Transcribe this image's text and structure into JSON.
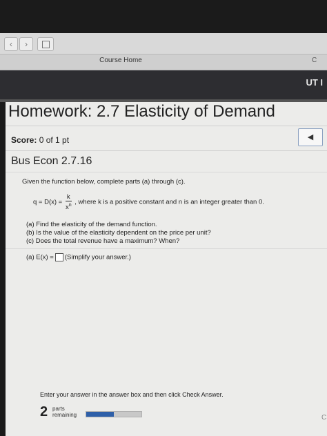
{
  "browser": {
    "back_icon": "‹",
    "forward_icon": "›",
    "tab_course_home": "Course Home",
    "tab_right_clip": "C"
  },
  "banner": {
    "text": "UT I"
  },
  "homework": {
    "title": "Homework: 2.7 Elasticity of Demand",
    "score_label": "Score:",
    "score_value": "0 of 1 pt",
    "nav_icon": "◀"
  },
  "question": {
    "id": "Bus Econ 2.7.16",
    "instruction": "Given the function below, complete parts (a) through (c).",
    "formula_lhs": "q = D(x) =",
    "formula_num": "k",
    "formula_den_base": "x",
    "formula_den_exp": "n",
    "formula_rest": ", where k is a positive constant and n is an integer greater than 0.",
    "part_a": "(a) Find the elasticity of the demand function.",
    "part_b": "(b) Is the value of the elasticity dependent on the price per unit?",
    "part_c": "(c) Does the total revenue have a maximum? When?",
    "answer_prefix": "(a) E(x) =",
    "answer_hint": "(Simplify your answer.)"
  },
  "footer": {
    "hint": "Enter your answer in the answer box and then click Check Answer.",
    "parts_count": "2",
    "parts_label_1": "parts",
    "parts_label_2": "remaining",
    "progress": 0.5,
    "corner_text": "C"
  },
  "colors": {
    "accent": "#2e5fa8",
    "banner": "#2d2d31"
  }
}
